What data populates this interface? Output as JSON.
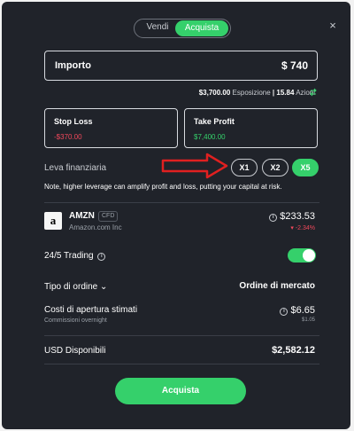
{
  "toggle": {
    "sell_label": "Vendi",
    "buy_label": "Acquista"
  },
  "close_icon": "×",
  "amount": {
    "label": "Importo",
    "value": "$  740"
  },
  "exposure": {
    "value": "$3,700.00",
    "label": "Esposizione",
    "sep": "|",
    "shares_value": "15.84",
    "shares_label": "Azioni"
  },
  "stop_loss": {
    "title": "Stop Loss",
    "value": "-$370.00"
  },
  "take_profit": {
    "title": "Take Profit",
    "value": "$7,400.00"
  },
  "leverage": {
    "label": "Leva finanziaria",
    "options": [
      "X1",
      "X2",
      "X5"
    ],
    "selected": "X5",
    "note": "Note, higher leverage can amplify profit and loss, putting your capital at risk."
  },
  "asset": {
    "logo": "a",
    "ticker": "AMZN",
    "badge": "CFD",
    "company": "Amazon.com Inc",
    "price": "$233.53",
    "change": "▾ -2.34%"
  },
  "trading": {
    "label": "24/5 Trading",
    "enabled": true
  },
  "order_type": {
    "label": "Tipo di ordine",
    "value": "Ordine di mercato"
  },
  "costs": {
    "label": "Costi di apertura stimati",
    "sub_label": "Commissioni overnight",
    "value": "$6.65",
    "sub_value": "$1.05"
  },
  "available": {
    "label": "USD Disponibili",
    "value": "$2,582.12"
  },
  "buy_button": "Acquista",
  "colors": {
    "accent": "#35d06b",
    "loss": "#f0485b",
    "background": "#20232a",
    "annotation_arrow": "#e02020"
  }
}
